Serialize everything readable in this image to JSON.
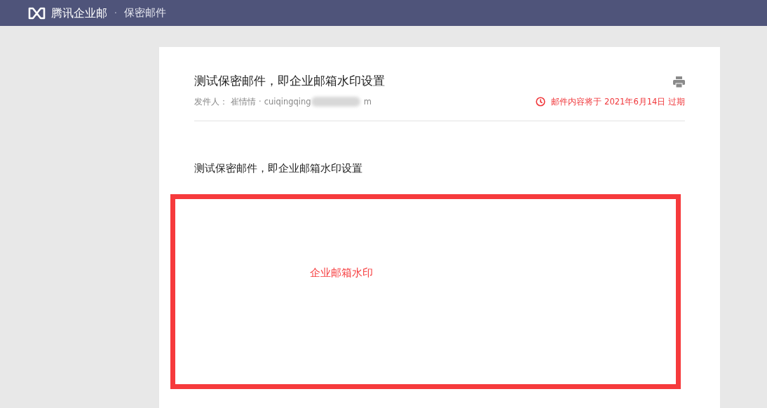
{
  "header": {
    "product_name": "腾讯企业邮",
    "separator": "·",
    "page_title": "保密邮件"
  },
  "mail": {
    "subject": "测试保密邮件，即企业邮箱水印设置",
    "sender_label": "发件人：",
    "sender_name": "崔情情",
    "sender_separator": "·",
    "sender_email_visible": "cuiqingqing",
    "sender_email_tail": "m",
    "expiry_notice": "邮件内容将于 2021年6月14日 过期",
    "body_text": "测试保密邮件，即企业邮箱水印设置"
  },
  "annotation": {
    "label": "企业邮箱水印",
    "color": "#f63a3c"
  }
}
